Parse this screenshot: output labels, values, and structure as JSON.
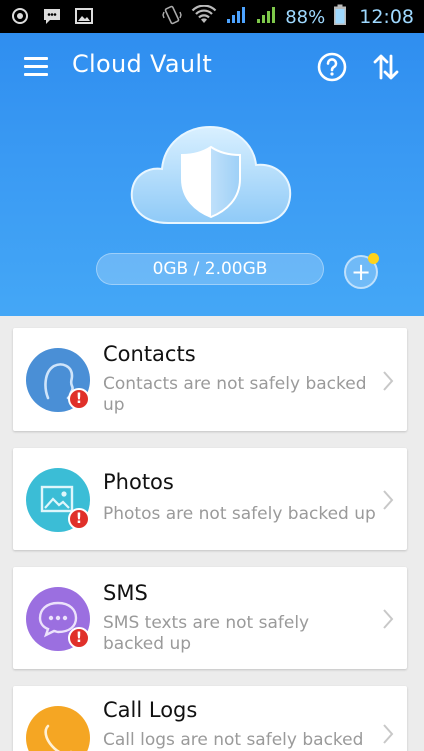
{
  "status_bar": {
    "battery_percent": "88%",
    "time": "12:08"
  },
  "header": {
    "title": "Cloud Vault",
    "storage": "0GB / 2.00GB"
  },
  "cards": [
    {
      "title": "Contacts",
      "description": "Contacts are not safely backed up",
      "color": "#4a8fd6"
    },
    {
      "title": "Photos",
      "description": "Photos are not safely backed up",
      "color": "#3bbdd6"
    },
    {
      "title": "SMS",
      "description": "SMS texts are not safely backed up",
      "color": "#9b6fe0"
    },
    {
      "title": "Call Logs",
      "description": "Call logs are not safely backed",
      "color": "#f5a623"
    }
  ],
  "colors": {
    "header_blue": "#3a9af3",
    "warning_red": "#e0302a",
    "notification_dot": "#ffd31a"
  }
}
